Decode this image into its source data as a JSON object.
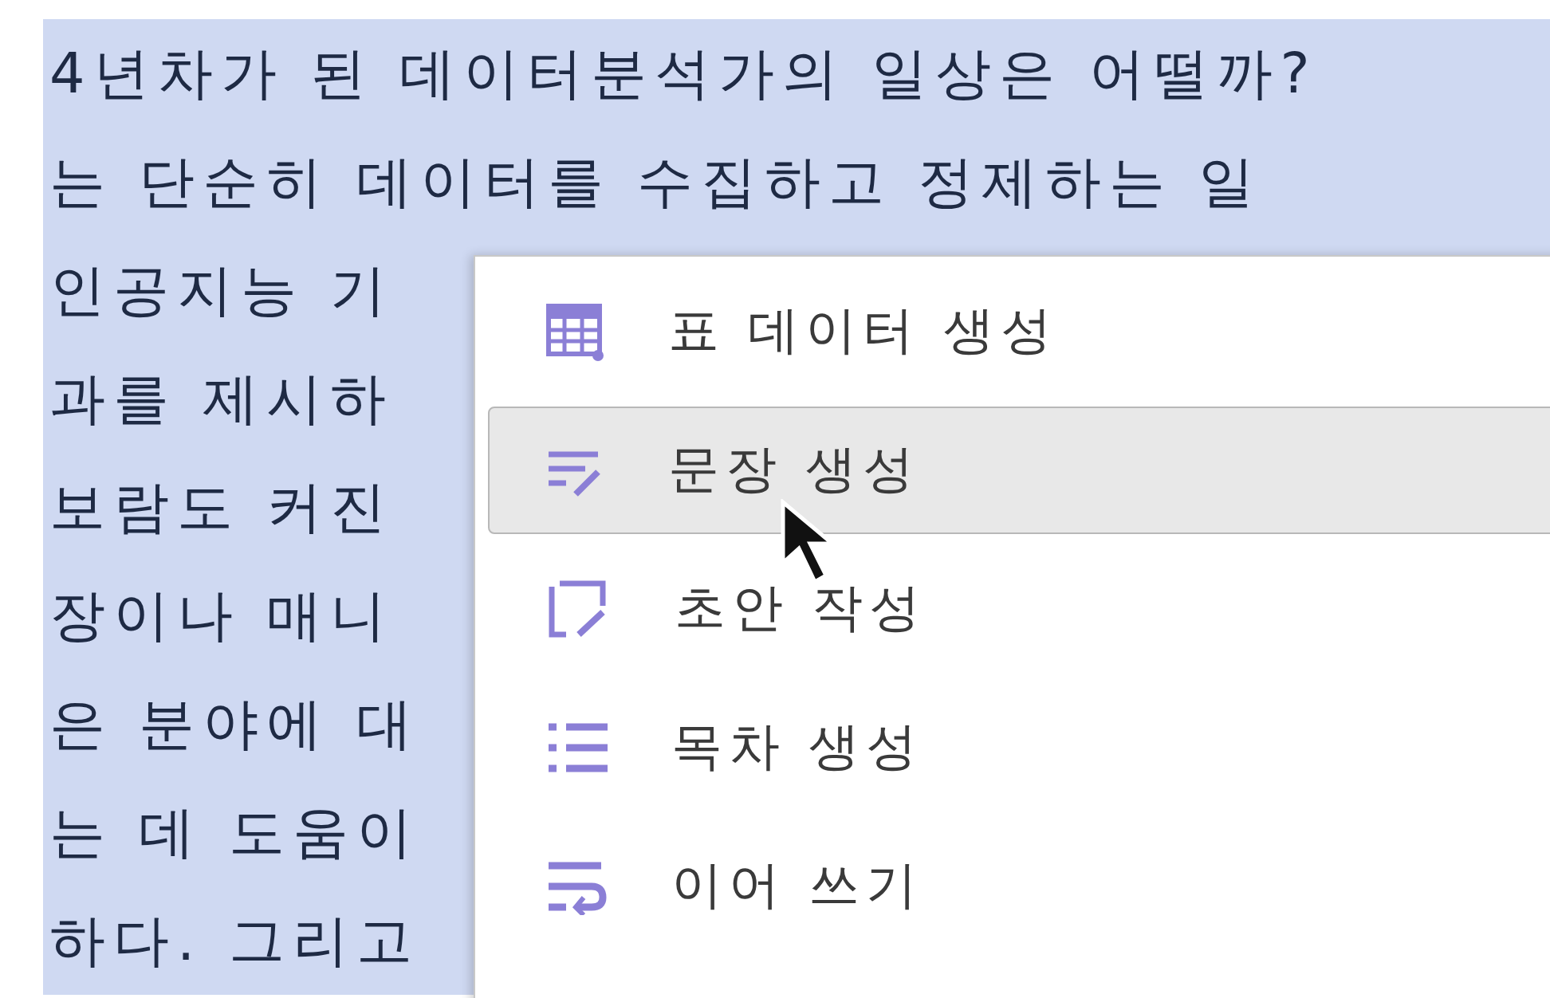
{
  "document": {
    "lines": [
      {
        "text": "4년차가 된 데이터분석가의 일상은 어떨까?",
        "selected": true
      },
      {
        "text": "는 단순히 데이터를 수집하고 정제하는 일",
        "selected": true
      },
      {
        "text": "인공지능 기",
        "selected": true
      },
      {
        "text": "과를 제시하",
        "selected": true
      },
      {
        "text": "보람도 커진",
        "selected": true
      },
      {
        "text": "장이나 매니",
        "selected": true
      },
      {
        "text": "은 분야에 대",
        "selected": true
      },
      {
        "text": "는 데 도움이",
        "selected": true
      },
      {
        "text": "하다. 그리고",
        "selected": true
      }
    ]
  },
  "context_menu": {
    "items": [
      {
        "label": "표 데이터 생성",
        "selected": false
      },
      {
        "label": "문장 생성",
        "selected": true
      },
      {
        "label": "초안 작성",
        "selected": false
      },
      {
        "label": "목차 생성",
        "selected": false
      },
      {
        "label": "이어 쓰기",
        "selected": false
      }
    ]
  }
}
